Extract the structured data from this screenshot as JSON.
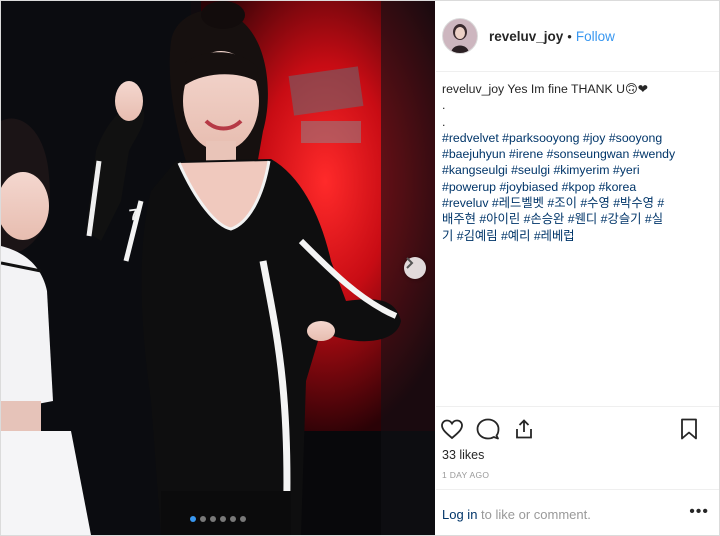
{
  "post": {
    "header": {
      "username": "reveluv_joy",
      "separator": "•",
      "follow_label": "Follow"
    },
    "caption": {
      "username": "reveluv_joy",
      "text": "Yes Im fine THANK U",
      "emoji": "🙃❤",
      "dot_lines": [
        ".",
        "."
      ],
      "hashtag_lines": [
        [
          "#redvelvet",
          "#parksooyong",
          "#joy",
          "#sooyong"
        ],
        [
          "#baejuhyun",
          "#irene",
          "#sonseungwan",
          "#wendy"
        ],
        [
          "#kangseulgi",
          "#seulgi",
          "#kimyerim",
          "#yeri"
        ],
        [
          "#powerup",
          "#joybiased",
          "#kpop",
          "#korea"
        ],
        [
          "#reveluv",
          "#레드벨벳",
          "#조이",
          "#수영",
          "#박수영",
          "#"
        ],
        [
          "배주현",
          "#아이린",
          "#손승완",
          "#웬디",
          "#강슬기",
          "#실"
        ],
        [
          "기",
          "#김예림",
          "#예리",
          "#레베럽"
        ]
      ]
    },
    "likes": "33 likes",
    "timestamp": "1 DAY AGO",
    "login_link": "Log in",
    "login_text": " to like or comment.",
    "more_label": "•••",
    "carousel": {
      "total": 6,
      "active_index": 0
    }
  },
  "icons": {
    "like": "heart-icon",
    "comment": "comment-icon",
    "share": "share-icon",
    "save": "bookmark-icon",
    "next": "chevron-right-icon"
  },
  "colors": {
    "accent": "#3897f0",
    "hashtag": "#003569",
    "meta": "#999999",
    "stage_red": "#e0101a"
  }
}
